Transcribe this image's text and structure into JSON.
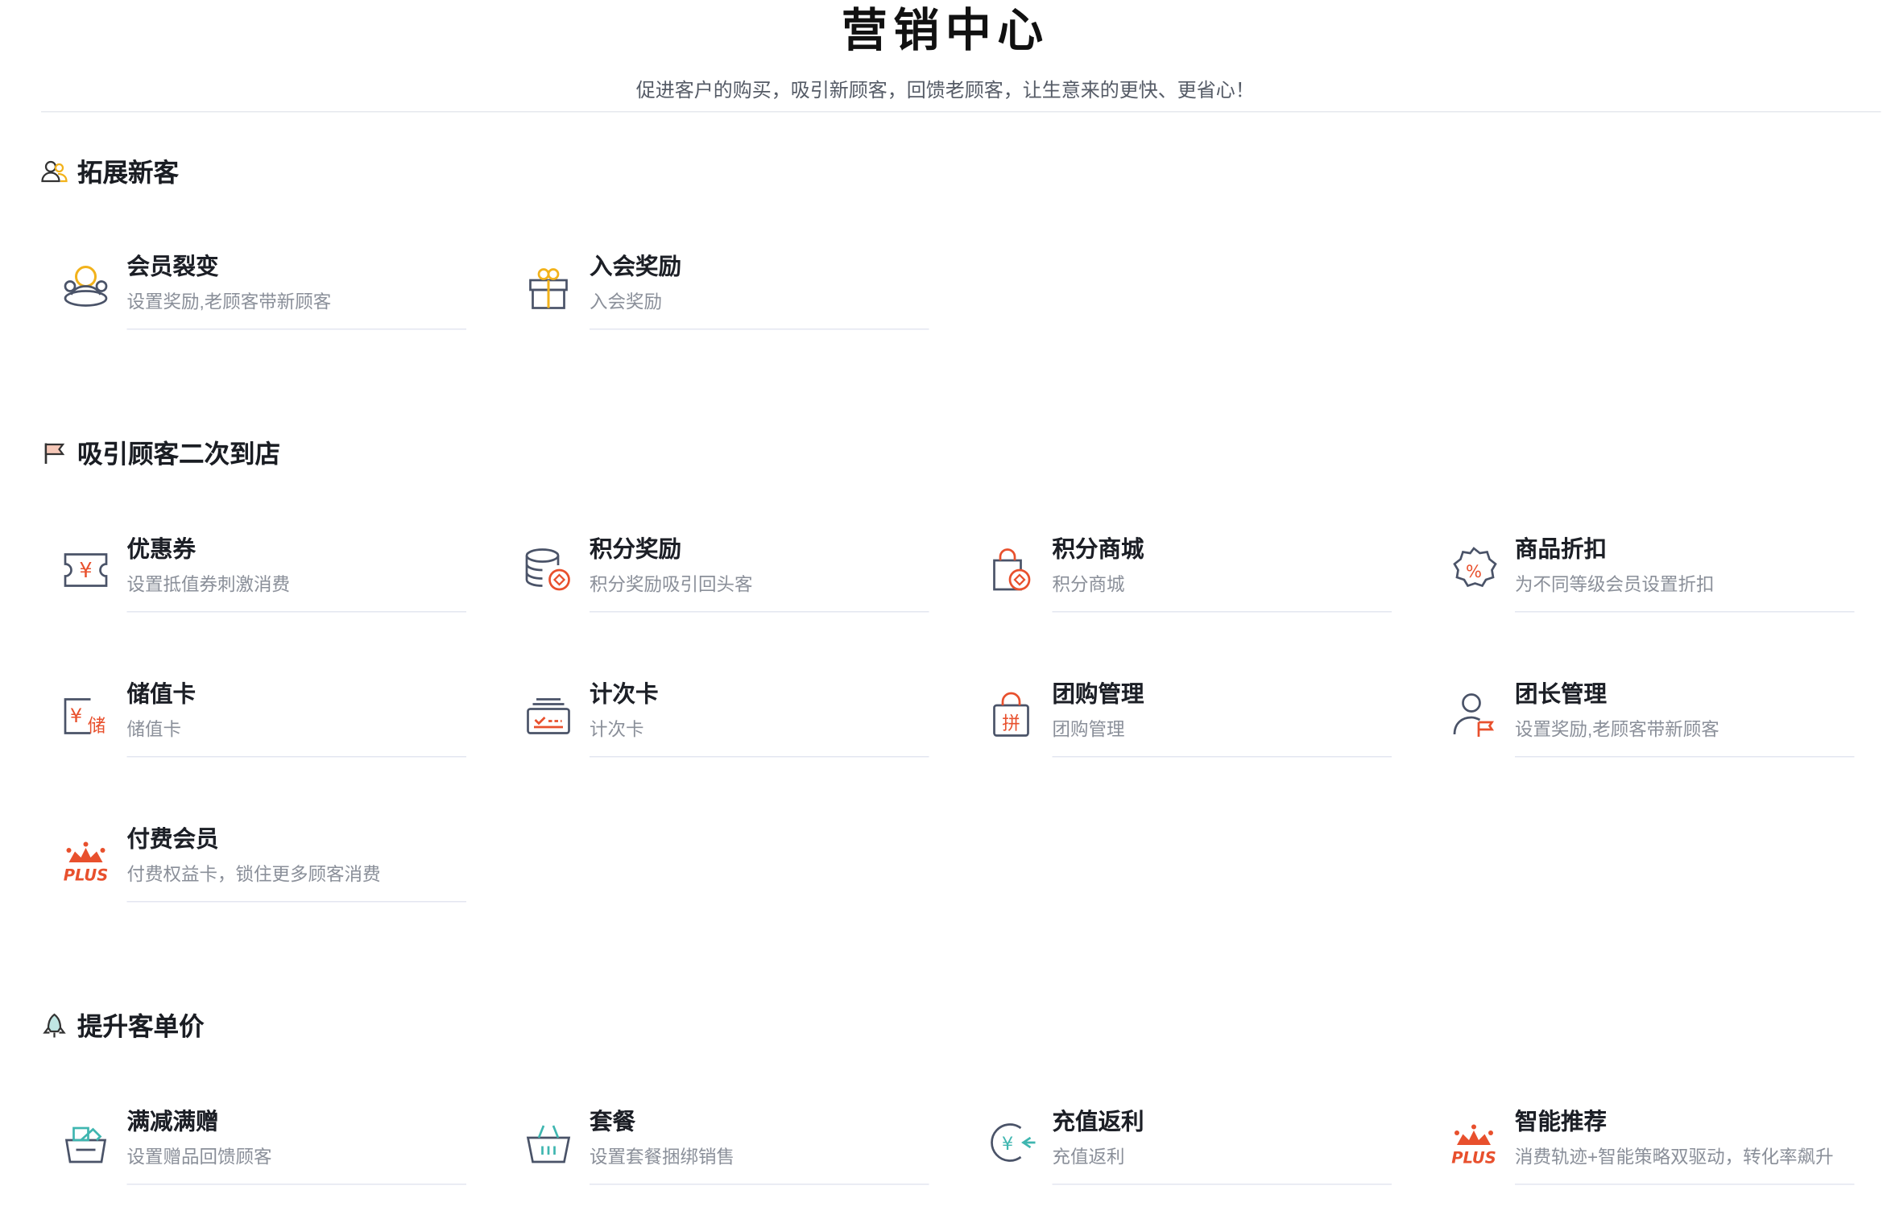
{
  "header": {
    "title": "营销中心",
    "subtitle": "促进客户的购买，吸引新顾客，回馈老顾客，让生意来的更快、更省心！"
  },
  "sections": [
    {
      "title": "拓展新客",
      "icon": "users-icon",
      "items": [
        {
          "title": "会员裂变",
          "desc": "设置奖励,老顾客带新顾客",
          "icon": "member-fission-icon"
        },
        {
          "title": "入会奖励",
          "desc": "入会奖励",
          "icon": "gift-icon"
        }
      ]
    },
    {
      "title": "吸引顾客二次到店",
      "icon": "flag-icon",
      "items": [
        {
          "title": "优惠券",
          "desc": "设置抵值券刺激消费",
          "icon": "coupon-icon"
        },
        {
          "title": "积分奖励",
          "desc": "积分奖励吸引回头客",
          "icon": "coin-stack-icon"
        },
        {
          "title": "积分商城",
          "desc": "积分商城",
          "icon": "shopping-bag-icon"
        },
        {
          "title": "商品折扣",
          "desc": "为不同等级会员设置折扣",
          "icon": "discount-badge-icon"
        },
        {
          "title": "储值卡",
          "desc": "储值卡",
          "icon": "stored-value-card-icon"
        },
        {
          "title": "计次卡",
          "desc": "计次卡",
          "icon": "punch-card-icon"
        },
        {
          "title": "团购管理",
          "desc": "团购管理",
          "icon": "group-buy-bag-icon"
        },
        {
          "title": "团长管理",
          "desc": "设置奖励,老顾客带新顾客",
          "icon": "group-leader-icon"
        },
        {
          "title": "付费会员",
          "desc": "付费权益卡，锁住更多顾客消费",
          "icon": "plus-crown-icon",
          "badge": "PLUS"
        }
      ]
    },
    {
      "title": "提升客单价",
      "icon": "rocket-icon",
      "items": [
        {
          "title": "满减满赠",
          "desc": "设置赠品回馈顾客",
          "icon": "basket-gift-icon"
        },
        {
          "title": "套餐",
          "desc": "设置套餐捆绑销售",
          "icon": "basket-icon"
        },
        {
          "title": "充值返利",
          "desc": "充值返利",
          "icon": "recharge-rebate-icon"
        },
        {
          "title": "智能推荐",
          "desc": "消费轨迹+智能策略双驱动，转化率飙升",
          "icon": "plus-crown-icon",
          "badge": "PLUS"
        }
      ]
    }
  ],
  "colors": {
    "accent": "#e8502d",
    "outline": "#4a5368",
    "gold": "#f2b21b",
    "teal": "#3fb6b0"
  }
}
